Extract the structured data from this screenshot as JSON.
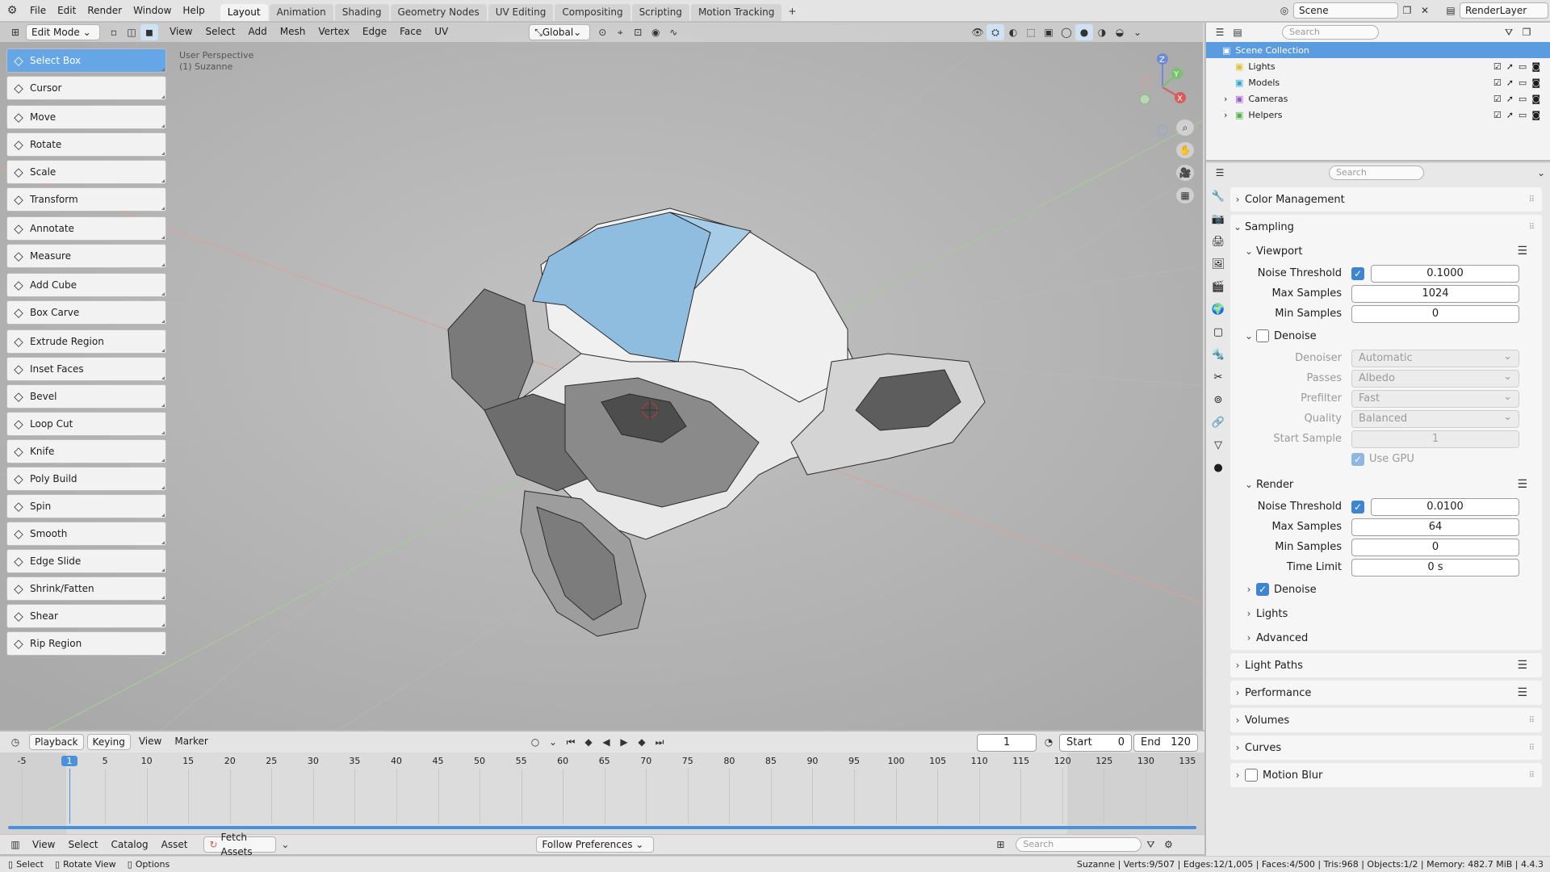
{
  "topbar": {
    "menus": [
      "File",
      "Edit",
      "Render",
      "Window",
      "Help"
    ],
    "tabs": [
      "Layout",
      "Animation",
      "Shading",
      "Geometry Nodes",
      "UV Editing",
      "Compositing",
      "Scripting",
      "Motion Tracking"
    ],
    "active_tab": "Layout",
    "scene_name": "Scene",
    "view_layer": "RenderLayer"
  },
  "viewport": {
    "mode": "Edit Mode",
    "menus": [
      "View",
      "Select",
      "Add",
      "Mesh",
      "Vertex",
      "Edge",
      "Face",
      "UV"
    ],
    "transform_orientation": "Global",
    "overlay_line1": "User Perspective",
    "overlay_line2": "(1) Suzanne",
    "gizmo": {
      "x": "X",
      "y": "Y",
      "z": "Z"
    }
  },
  "toolbar": {
    "groups": [
      [
        {
          "label": "Select Box",
          "icon": "select-box-icon",
          "active": true
        },
        {
          "label": "Cursor",
          "icon": "cursor-icon"
        }
      ],
      [
        {
          "label": "Move",
          "icon": "move-icon"
        },
        {
          "label": "Rotate",
          "icon": "rotate-icon"
        },
        {
          "label": "Scale",
          "icon": "scale-icon"
        },
        {
          "label": "Transform",
          "icon": "transform-icon"
        }
      ],
      [
        {
          "label": "Annotate",
          "icon": "annotate-icon"
        },
        {
          "label": "Measure",
          "icon": "measure-icon"
        }
      ],
      [
        {
          "label": "Add Cube",
          "icon": "add-cube-icon"
        },
        {
          "label": "Box Carve",
          "icon": "box-carve-icon"
        }
      ],
      [
        {
          "label": "Extrude Region",
          "icon": "extrude-icon"
        },
        {
          "label": "Inset Faces",
          "icon": "inset-icon"
        },
        {
          "label": "Bevel",
          "icon": "bevel-icon"
        },
        {
          "label": "Loop Cut",
          "icon": "loop-cut-icon"
        },
        {
          "label": "Knife",
          "icon": "knife-icon"
        },
        {
          "label": "Poly Build",
          "icon": "poly-build-icon"
        },
        {
          "label": "Spin",
          "icon": "spin-icon"
        },
        {
          "label": "Smooth",
          "icon": "smooth-icon"
        },
        {
          "label": "Edge Slide",
          "icon": "edge-slide-icon"
        },
        {
          "label": "Shrink/Fatten",
          "icon": "shrink-fatten-icon"
        },
        {
          "label": "Shear",
          "icon": "shear-icon"
        },
        {
          "label": "Rip Region",
          "icon": "rip-region-icon"
        }
      ]
    ]
  },
  "outliner": {
    "search_placeholder": "Search",
    "root": "Scene Collection",
    "items": [
      {
        "label": "Lights",
        "color": "#e2c034",
        "expand": false
      },
      {
        "label": "Models",
        "color": "#3aa6d6",
        "expand": false
      },
      {
        "label": "Cameras",
        "color": "#9c5ad0",
        "expand": true
      },
      {
        "label": "Helpers",
        "color": "#4fb34a",
        "expand": true
      }
    ]
  },
  "properties": {
    "search_placeholder": "Search",
    "color_management": "Color Management",
    "sampling": "Sampling",
    "viewport": {
      "title": "Viewport",
      "noise_threshold_label": "Noise Threshold",
      "noise_threshold": "0.1000",
      "max_samples_label": "Max Samples",
      "max_samples": "1024",
      "min_samples_label": "Min Samples",
      "min_samples": "0",
      "denoise_label": "Denoise",
      "denoiser_label": "Denoiser",
      "denoiser": "Automatic",
      "passes_label": "Passes",
      "passes": "Albedo",
      "prefilter_label": "Prefilter",
      "prefilter": "Fast",
      "quality_label": "Quality",
      "quality": "Balanced",
      "start_sample_label": "Start Sample",
      "start_sample": "1",
      "use_gpu_label": "Use GPU"
    },
    "render": {
      "title": "Render",
      "noise_threshold_label": "Noise Threshold",
      "noise_threshold": "0.0100",
      "max_samples_label": "Max Samples",
      "max_samples": "64",
      "min_samples_label": "Min Samples",
      "min_samples": "0",
      "time_limit_label": "Time Limit",
      "time_limit": "0 s",
      "denoise_label": "Denoise"
    },
    "sub_lights": "Lights",
    "sub_advanced": "Advanced",
    "light_paths": "Light Paths",
    "performance": "Performance",
    "volumes": "Volumes",
    "curves": "Curves",
    "motion_blur": "Motion Blur"
  },
  "timeline": {
    "menus": [
      "Playback",
      "Keying",
      "View",
      "Marker"
    ],
    "current_frame": "1",
    "start_label": "Start",
    "start": "0",
    "end_label": "End",
    "end": "120",
    "ticks": [
      "-5",
      "1",
      "5",
      "10",
      "15",
      "20",
      "25",
      "30",
      "35",
      "40",
      "45",
      "50",
      "55",
      "60",
      "65",
      "70",
      "75",
      "80",
      "85",
      "90",
      "95",
      "100",
      "105",
      "110",
      "115",
      "120",
      "125",
      "130",
      "135"
    ]
  },
  "assetbar": {
    "menus": [
      "View",
      "Select",
      "Catalog",
      "Asset"
    ],
    "fetch": "Fetch Assets",
    "follow": "Follow Preferences",
    "search_placeholder": "Search"
  },
  "statusbar": {
    "select": "Select",
    "rotate": "Rotate View",
    "options": "Options",
    "stats": "Suzanne | Verts:9/507 | Edges:12/1,005 | Faces:4/500 | Tris:968 | Objects:1/2 | Memory: 482.7 MiB | 4.4.3"
  },
  "colors": {
    "accent": "#64a6e6",
    "selected_face": "#8ebde0",
    "check": "#3f84d1"
  }
}
